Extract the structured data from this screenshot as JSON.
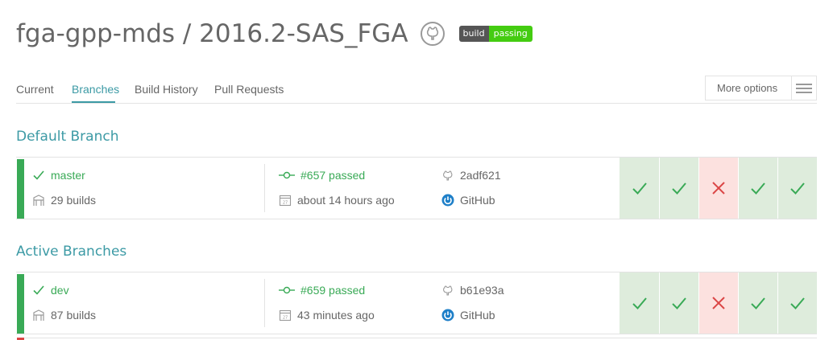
{
  "header": {
    "repo_title": "fga-gpp-mds / 2016.2-SAS_FGA",
    "badge_left": "build",
    "badge_right": "passing"
  },
  "tabs": [
    {
      "label": "Current"
    },
    {
      "label": "Branches",
      "active": true
    },
    {
      "label": "Build History"
    },
    {
      "label": "Pull Requests"
    }
  ],
  "more_options": {
    "label": "More options"
  },
  "sections": {
    "default_title": "Default Branch",
    "active_title": "Active Branches"
  },
  "branches": [
    {
      "name": "master",
      "builds": "29 builds",
      "build_status": "#657 passed",
      "time": "about 14 hours ago",
      "commit": "2adf621",
      "provider": "GitHub",
      "history": [
        "passed",
        "passed",
        "failed",
        "passed",
        "passed"
      ]
    },
    {
      "name": "dev",
      "builds": "87 builds",
      "build_status": "#659 passed",
      "time": "43 minutes ago",
      "commit": "b61e93a",
      "provider": "GitHub",
      "history": [
        "passed",
        "passed",
        "failed",
        "passed",
        "passed"
      ]
    }
  ],
  "colors": {
    "accent": "#3c9aa5",
    "passed": "#39aa56",
    "failed": "#db4545",
    "passed_bg": "#deecdc",
    "failed_bg": "#fce1df"
  }
}
